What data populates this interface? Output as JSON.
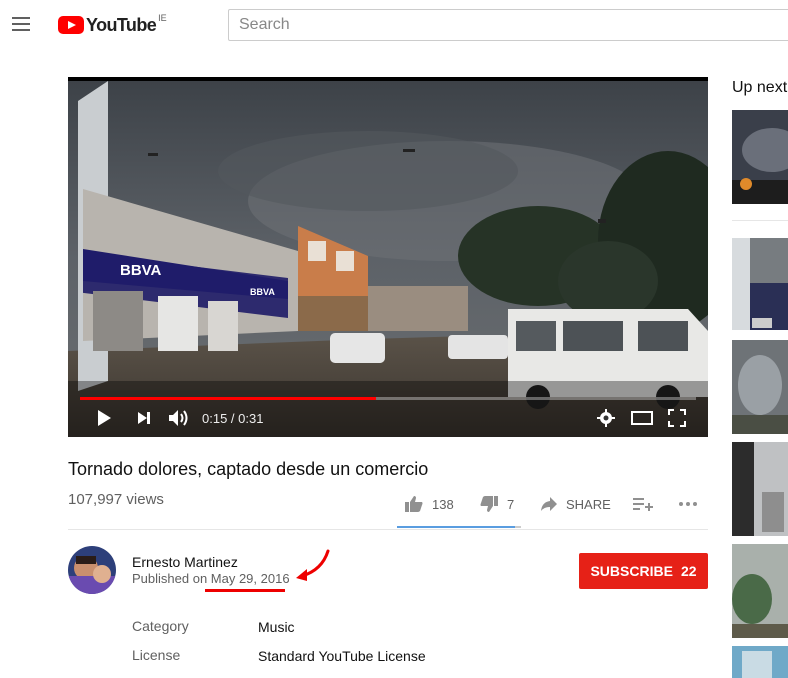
{
  "header": {
    "logo_text": "YouTube",
    "region": "IE",
    "search_placeholder": "Search"
  },
  "player": {
    "time_current": "0:15",
    "time_total": "0:31",
    "time_display": "0:15 / 0:31",
    "progress_fraction": 0.48,
    "billboard_text": "BBVA",
    "billboard_text_small": "BBVA"
  },
  "video": {
    "title": "Tornado dolores, captado desde un comercio",
    "views": "107,997 views",
    "likes": "138",
    "dislikes": "7",
    "share_label": "SHARE",
    "like_ratio": 0.95
  },
  "channel": {
    "name": "Ernesto Martinez",
    "published_prefix": "Published on ",
    "published_date": "May 29, 2016",
    "subscribe_label": "SUBSCRIBE",
    "subscriber_count": "22"
  },
  "meta": [
    {
      "label": "Category",
      "value": "Music"
    },
    {
      "label": "License",
      "value": "Standard YouTube License"
    }
  ],
  "sidebar": {
    "up_next_label": "Up next"
  },
  "colors": {
    "brand_red": "#ff0000",
    "subscribe_red": "#e62117",
    "annotation_red": "#e00000",
    "like_bar_blue": "#5a9de0"
  }
}
